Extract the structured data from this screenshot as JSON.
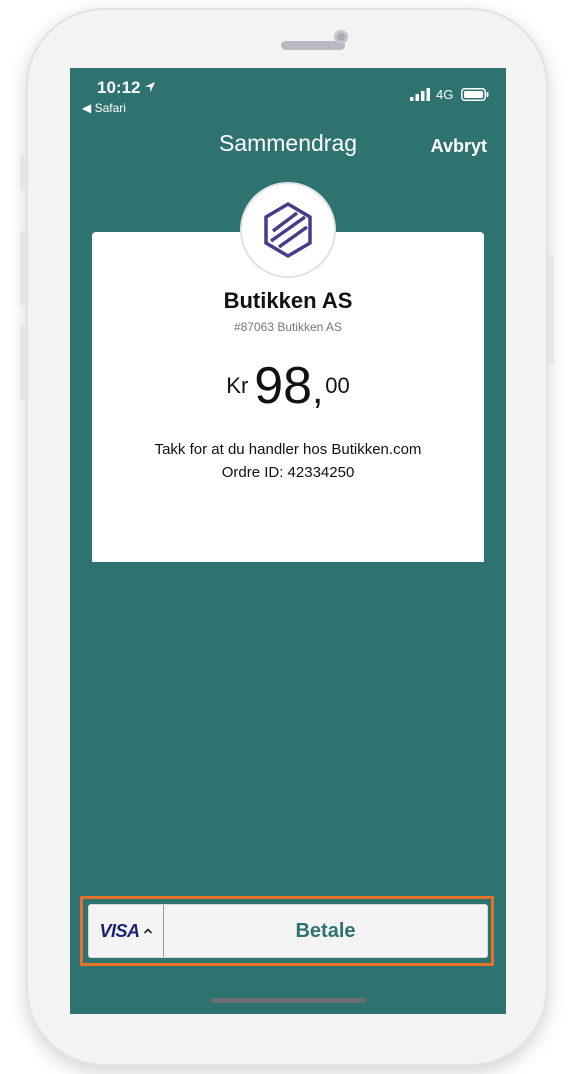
{
  "status_bar": {
    "time": "10:12",
    "back_app": "◀ Safari",
    "network": "4G"
  },
  "nav": {
    "title": "Sammendrag",
    "cancel_label": "Avbryt"
  },
  "receipt": {
    "merchant_name": "Butikken AS",
    "merchant_id": "#87063 Butikken AS",
    "currency": "Kr",
    "amount_integer": "98",
    "amount_separator": ",",
    "amount_decimals": "00",
    "thanks_text": "Takk for at du handler hos Butikken.com",
    "order_text": "Ordre ID: 42334250"
  },
  "payment": {
    "card_brand": "VISA",
    "pay_label": "Betale"
  },
  "colors": {
    "screen_bg": "#2f7370",
    "highlight": "#e4722d",
    "logo": "#4a3a8a"
  }
}
